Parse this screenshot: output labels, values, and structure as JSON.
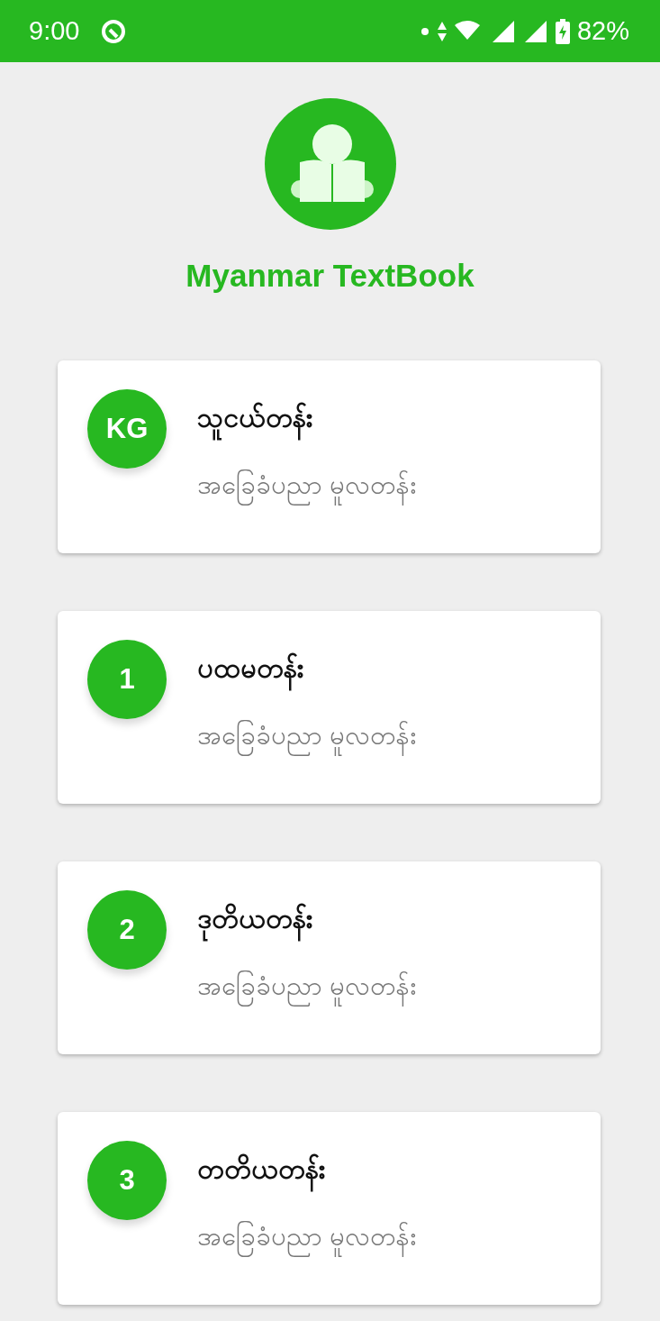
{
  "status_bar": {
    "time": "9:00",
    "battery": "82%"
  },
  "app": {
    "title": "Myanmar TextBook"
  },
  "grades": [
    {
      "badge": "KG",
      "title": "သူငယ်တန်း",
      "subtitle": "အခြေခံပညာ မူလတန်း"
    },
    {
      "badge": "1",
      "title": "ပထမတန်း",
      "subtitle": "အခြေခံပညာ မူလတန်း"
    },
    {
      "badge": "2",
      "title": "ဒုတိယတန်း",
      "subtitle": "အခြေခံပညာ မူလတန်း"
    },
    {
      "badge": "3",
      "title": "တတိယတန်း",
      "subtitle": "အခြေခံပညာ မူလတန်း"
    }
  ]
}
